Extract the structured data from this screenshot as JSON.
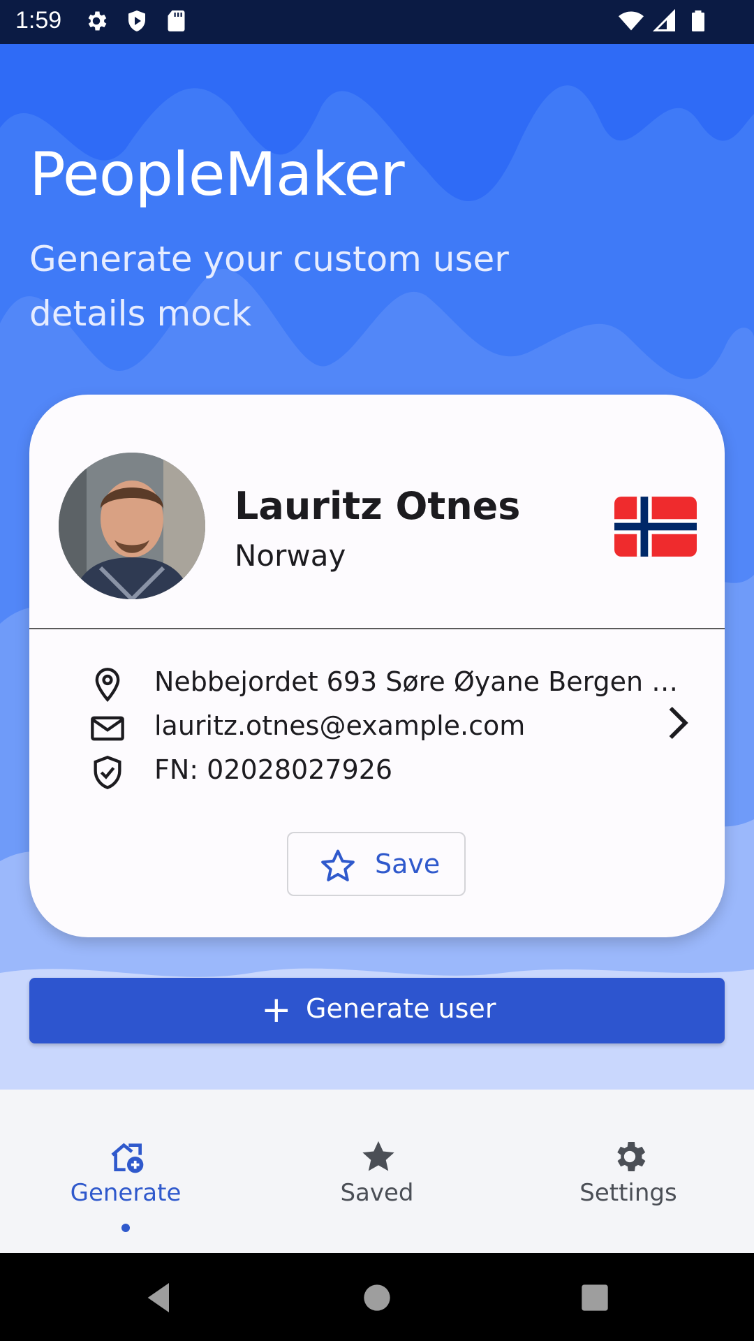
{
  "status_bar": {
    "time": "1:59",
    "icons": [
      "gear-icon",
      "shield-icon",
      "sd-card-icon",
      "wifi-icon",
      "signal-icon",
      "battery-icon"
    ]
  },
  "header": {
    "title": "PeopleMaker",
    "subtitle": "Generate your custom user details mock"
  },
  "card": {
    "name": "Lauritz Otnes",
    "country": "Norway",
    "flag": "norway-flag",
    "address": "Nebbejordet 693 Søre Øyane Bergen …",
    "email": "lauritz.otnes@example.com",
    "id": "FN: 02028027926",
    "save_label": "Save"
  },
  "actions": {
    "generate_label": "Generate user"
  },
  "bottom_nav": {
    "items": [
      {
        "label": "Generate",
        "icon": "home-add-icon",
        "active": true
      },
      {
        "label": "Saved",
        "icon": "star-icon",
        "active": false
      },
      {
        "label": "Settings",
        "icon": "gear-icon",
        "active": false
      }
    ]
  },
  "colors": {
    "primary": "#2d55cf",
    "hero_blue": "#2f6bf6",
    "status_bar": "#0b1b44",
    "card_bg": "#fdfbfe"
  }
}
